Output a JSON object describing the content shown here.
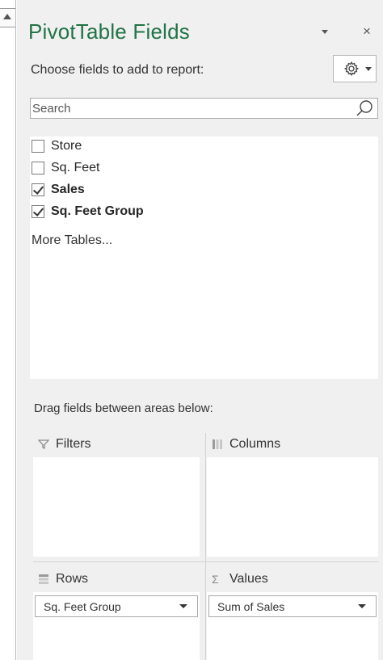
{
  "pane": {
    "title": "PivotTable Fields",
    "choose_label": "Choose fields to add to report:",
    "close_glyph": "×"
  },
  "search": {
    "placeholder": "Search"
  },
  "fields": [
    {
      "label": "Store",
      "checked": false
    },
    {
      "label": "Sq. Feet",
      "checked": false
    },
    {
      "label": "Sales",
      "checked": true
    },
    {
      "label": "Sq. Feet Group",
      "checked": true
    }
  ],
  "more_tables": "More Tables...",
  "drag_label": "Drag fields between areas below:",
  "areas": {
    "filters": {
      "title": "Filters",
      "icon": "filter-icon"
    },
    "columns": {
      "title": "Columns",
      "icon": "columns-icon"
    },
    "rows": {
      "title": "Rows",
      "icon": "rows-icon",
      "field": "Sq. Feet Group"
    },
    "values": {
      "title": "Values",
      "icon": "sigma-icon",
      "icon_glyph": "Σ",
      "field": "Sum of Sales"
    }
  },
  "colors": {
    "title": "#217346",
    "pane_bg": "#f0f0f0"
  }
}
